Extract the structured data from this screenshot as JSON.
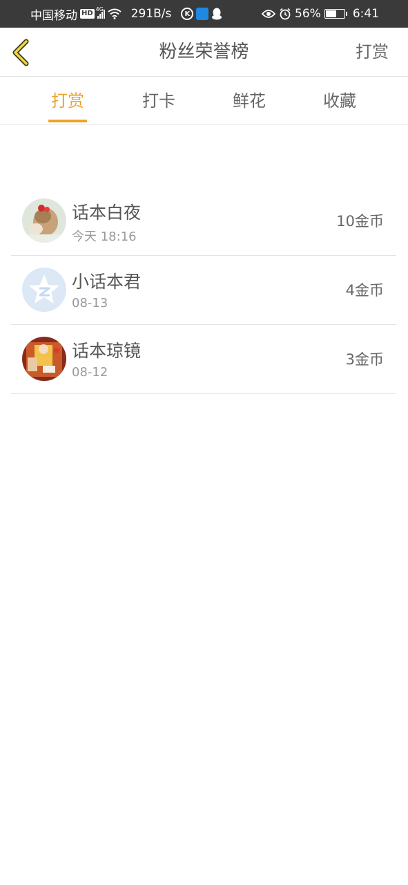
{
  "status_bar": {
    "carrier": "中国移动",
    "hd": "HD",
    "network": "4G",
    "speed": "291B/s",
    "k_icon": "K",
    "battery": "56%",
    "time": "6:41"
  },
  "header": {
    "title": "粉丝荣誉榜",
    "action": "打赏"
  },
  "tabs": [
    {
      "label": "打赏",
      "active": true
    },
    {
      "label": "打卡",
      "active": false
    },
    {
      "label": "鲜花",
      "active": false
    },
    {
      "label": "收藏",
      "active": false
    }
  ],
  "list": [
    {
      "name": "话本白夜",
      "time": "今天 18:16",
      "amount": "10金币",
      "avatar": "avatar-photo-girl"
    },
    {
      "name": "小话本君",
      "time": "08-13",
      "amount": "4金币",
      "avatar": "avatar-qq-default"
    },
    {
      "name": "话本琼镜",
      "time": "08-12",
      "amount": "3金币",
      "avatar": "avatar-illustration"
    }
  ],
  "colors": {
    "accent": "#eda32a",
    "status_bar_bg": "#3a3a3a",
    "divider": "#e3e3e3"
  }
}
